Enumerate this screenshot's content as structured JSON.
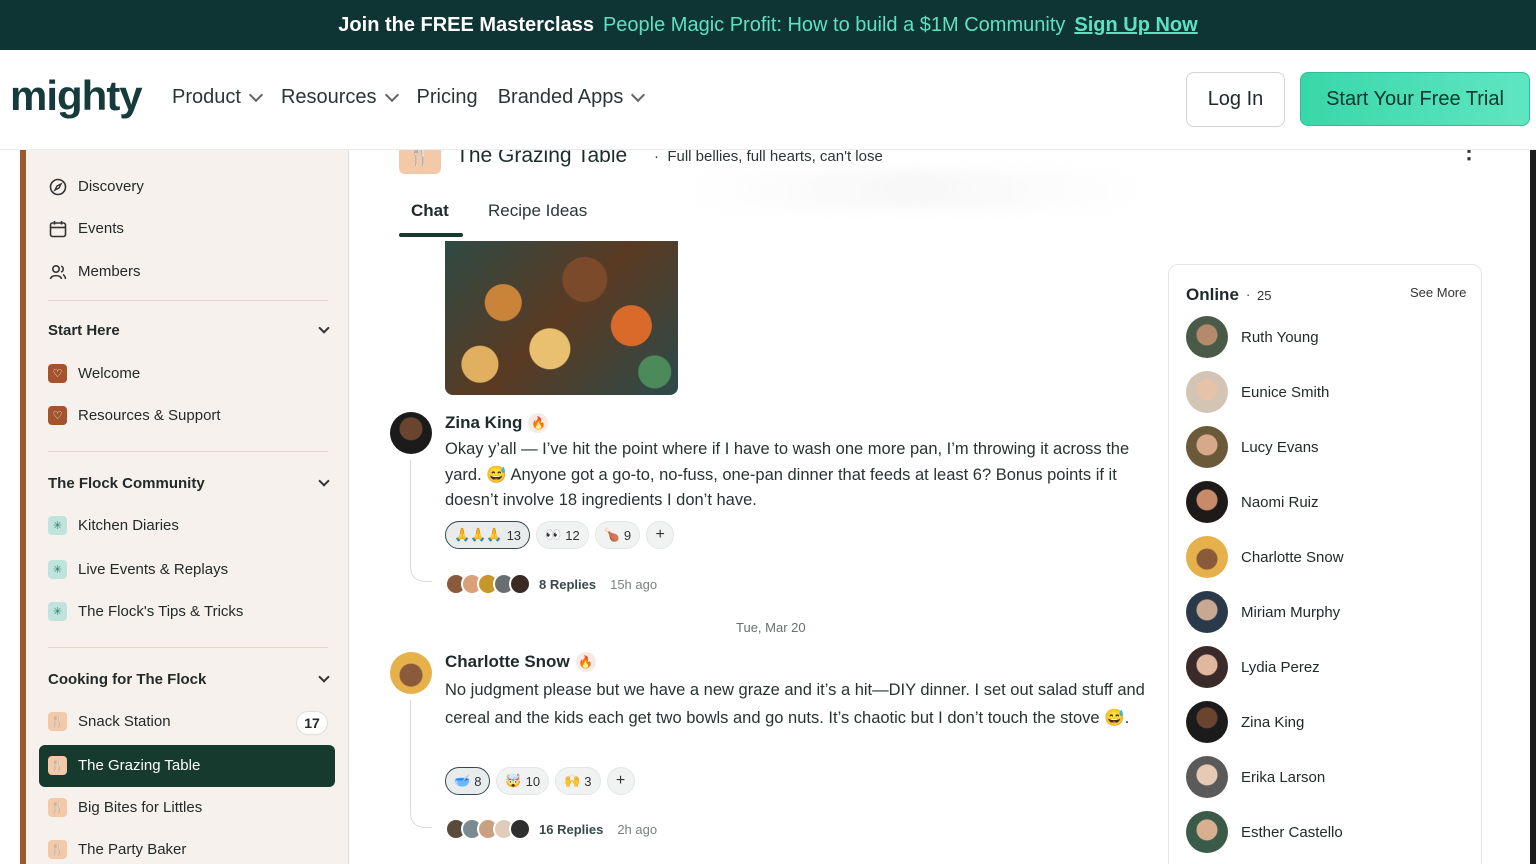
{
  "promo": {
    "lead": "Join the FREE Masterclass",
    "title": "People Magic Profit: How to build a $1M Community",
    "cta": "Sign Up Now"
  },
  "nav": {
    "logo": "mighty",
    "links": [
      {
        "label": "Product",
        "dropdown": true
      },
      {
        "label": "Resources",
        "dropdown": true
      },
      {
        "label": "Pricing",
        "dropdown": false
      },
      {
        "label": "Branded Apps",
        "dropdown": true
      }
    ],
    "login": "Log In",
    "trial": "Start Your Free Trial"
  },
  "sidebar": {
    "top_items": [
      {
        "label": "Discovery",
        "icon": "compass-icon"
      },
      {
        "label": "Events",
        "icon": "calendar-icon"
      },
      {
        "label": "Members",
        "icon": "people-icon"
      }
    ],
    "sections": [
      {
        "title": "Start Here",
        "items": [
          {
            "label": "Welcome"
          },
          {
            "label": "Resources & Support"
          }
        ]
      },
      {
        "title": "The Flock Community",
        "items": [
          {
            "label": "Kitchen Diaries"
          },
          {
            "label": "Live Events & Replays"
          },
          {
            "label": "The Flock's Tips & Tricks"
          }
        ]
      },
      {
        "title": "Cooking for The Flock",
        "items": [
          {
            "label": "Snack Station",
            "badge": "17"
          },
          {
            "label": "The Grazing Table",
            "active": true
          },
          {
            "label": "Big Bites for Littles"
          },
          {
            "label": "The Party Baker"
          }
        ]
      }
    ]
  },
  "channel": {
    "title": "The Grazing Table",
    "separator": "·",
    "tagline": "Full bellies, full hearts, can't lose",
    "tabs": [
      "Chat",
      "Recipe Ideas"
    ]
  },
  "messages": [
    {
      "author": "Zina King",
      "text": "Okay y’all — I’ve hit the point where if I have to wash one more pan, I’m throwing it across the yard. 😅 Anyone got a go-to, no-fuss, one-pan dinner that feeds at least 6? Bonus points if it doesn’t involve 18 ingredients I don’t have.",
      "reactions": [
        {
          "emoji": "🙏🙏🙏",
          "count": "13",
          "active": true
        },
        {
          "emoji": "👀",
          "count": "12"
        },
        {
          "emoji": "🍗",
          "count": "9"
        }
      ],
      "replies": "8 Replies",
      "time": "15h ago"
    },
    {
      "author": "Charlotte Snow",
      "text": "No judgment please but we have a new graze and it’s a hit—DIY dinner. I set out salad stuff and cereal and the kids each get two bowls and go nuts. It’s chaotic but I don’t touch the stove 😅.",
      "reactions": [
        {
          "emoji": "🥣",
          "count": "8",
          "active": true
        },
        {
          "emoji": "🤯",
          "count": "10"
        },
        {
          "emoji": "🙌",
          "count": "3"
        }
      ],
      "replies": "16 Replies",
      "time": "2h ago"
    }
  ],
  "date_separator": "Tue, Mar 20",
  "online": {
    "title": "Online",
    "dot": "·",
    "count": "25",
    "see_more": "See More",
    "members": [
      "Ruth Young",
      "Eunice Smith",
      "Lucy Evans",
      "Naomi Ruiz",
      "Charlotte Snow",
      "Miriam Murphy",
      "Lydia Perez",
      "Zina King",
      "Erika Larson",
      "Esther Castello"
    ]
  },
  "colors": {
    "banner_bg": "#0f3434",
    "accent": "#5fe0c3",
    "sidebar_bg": "#f6f1ec",
    "active_item": "#163a2e",
    "brown_accent": "#9a5a2e"
  },
  "more_icon": "⋮"
}
